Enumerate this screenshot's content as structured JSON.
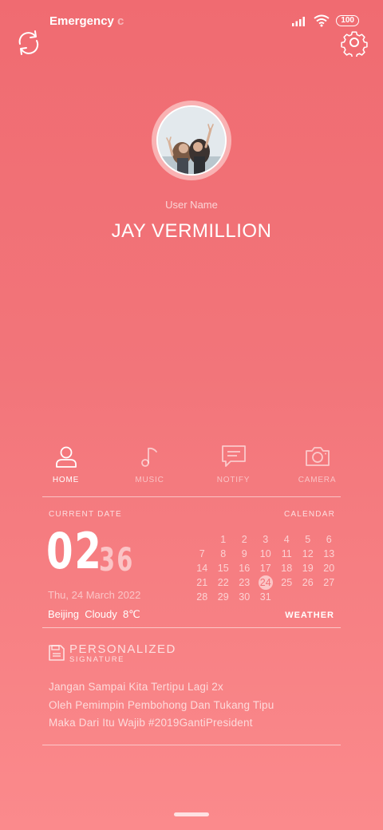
{
  "status_bar": {
    "carrier_text": "Emergency",
    "carrier_overflow": "c",
    "battery": "100"
  },
  "profile": {
    "name_label": "User Name",
    "name": "JAY VERMILLION"
  },
  "nav": {
    "items": [
      {
        "label": "HOME",
        "icon": "user-icon",
        "active": true
      },
      {
        "label": "MUSIC",
        "icon": "music-note-icon",
        "active": false
      },
      {
        "label": "NOTIFY",
        "icon": "chat-bubble-icon",
        "active": false
      },
      {
        "label": "CAMERA",
        "icon": "camera-icon",
        "active": false
      }
    ]
  },
  "clock": {
    "section_label": "CURRENT DATE",
    "hours": "02",
    "minutes": "36",
    "date": "Thu, 24 March 2022",
    "weather_text": "Beijing  Cloudy  8℃",
    "weather_link": "WEATHER"
  },
  "calendar": {
    "section_label": "CALENDAR",
    "today": "24",
    "rows": [
      [
        "",
        "1",
        "2",
        "3",
        "4",
        "5",
        "6"
      ],
      [
        "7",
        "8",
        "9",
        "10",
        "11",
        "12",
        "13"
      ],
      [
        "14",
        "15",
        "16",
        "17",
        "18",
        "19",
        "20"
      ],
      [
        "21",
        "22",
        "23",
        "24",
        "25",
        "26",
        "27"
      ],
      [
        "28",
        "29",
        "30",
        "31",
        "",
        "",
        ""
      ]
    ]
  },
  "signature": {
    "title": "PERSONALIZED",
    "subtitle": "SIGNATURE",
    "lines": [
      "Jangan Sampai Kita Tertipu Lagi 2x",
      "Oleh Pemimpin Pembohong Dan Tukang Tipu",
      "Maka Dari Itu Wajib #2019GantiPresident"
    ]
  },
  "colors": {
    "background_top": "#f06b71",
    "background_bottom": "#fb8a8c",
    "avatar_ring": "#f9b2b3"
  }
}
